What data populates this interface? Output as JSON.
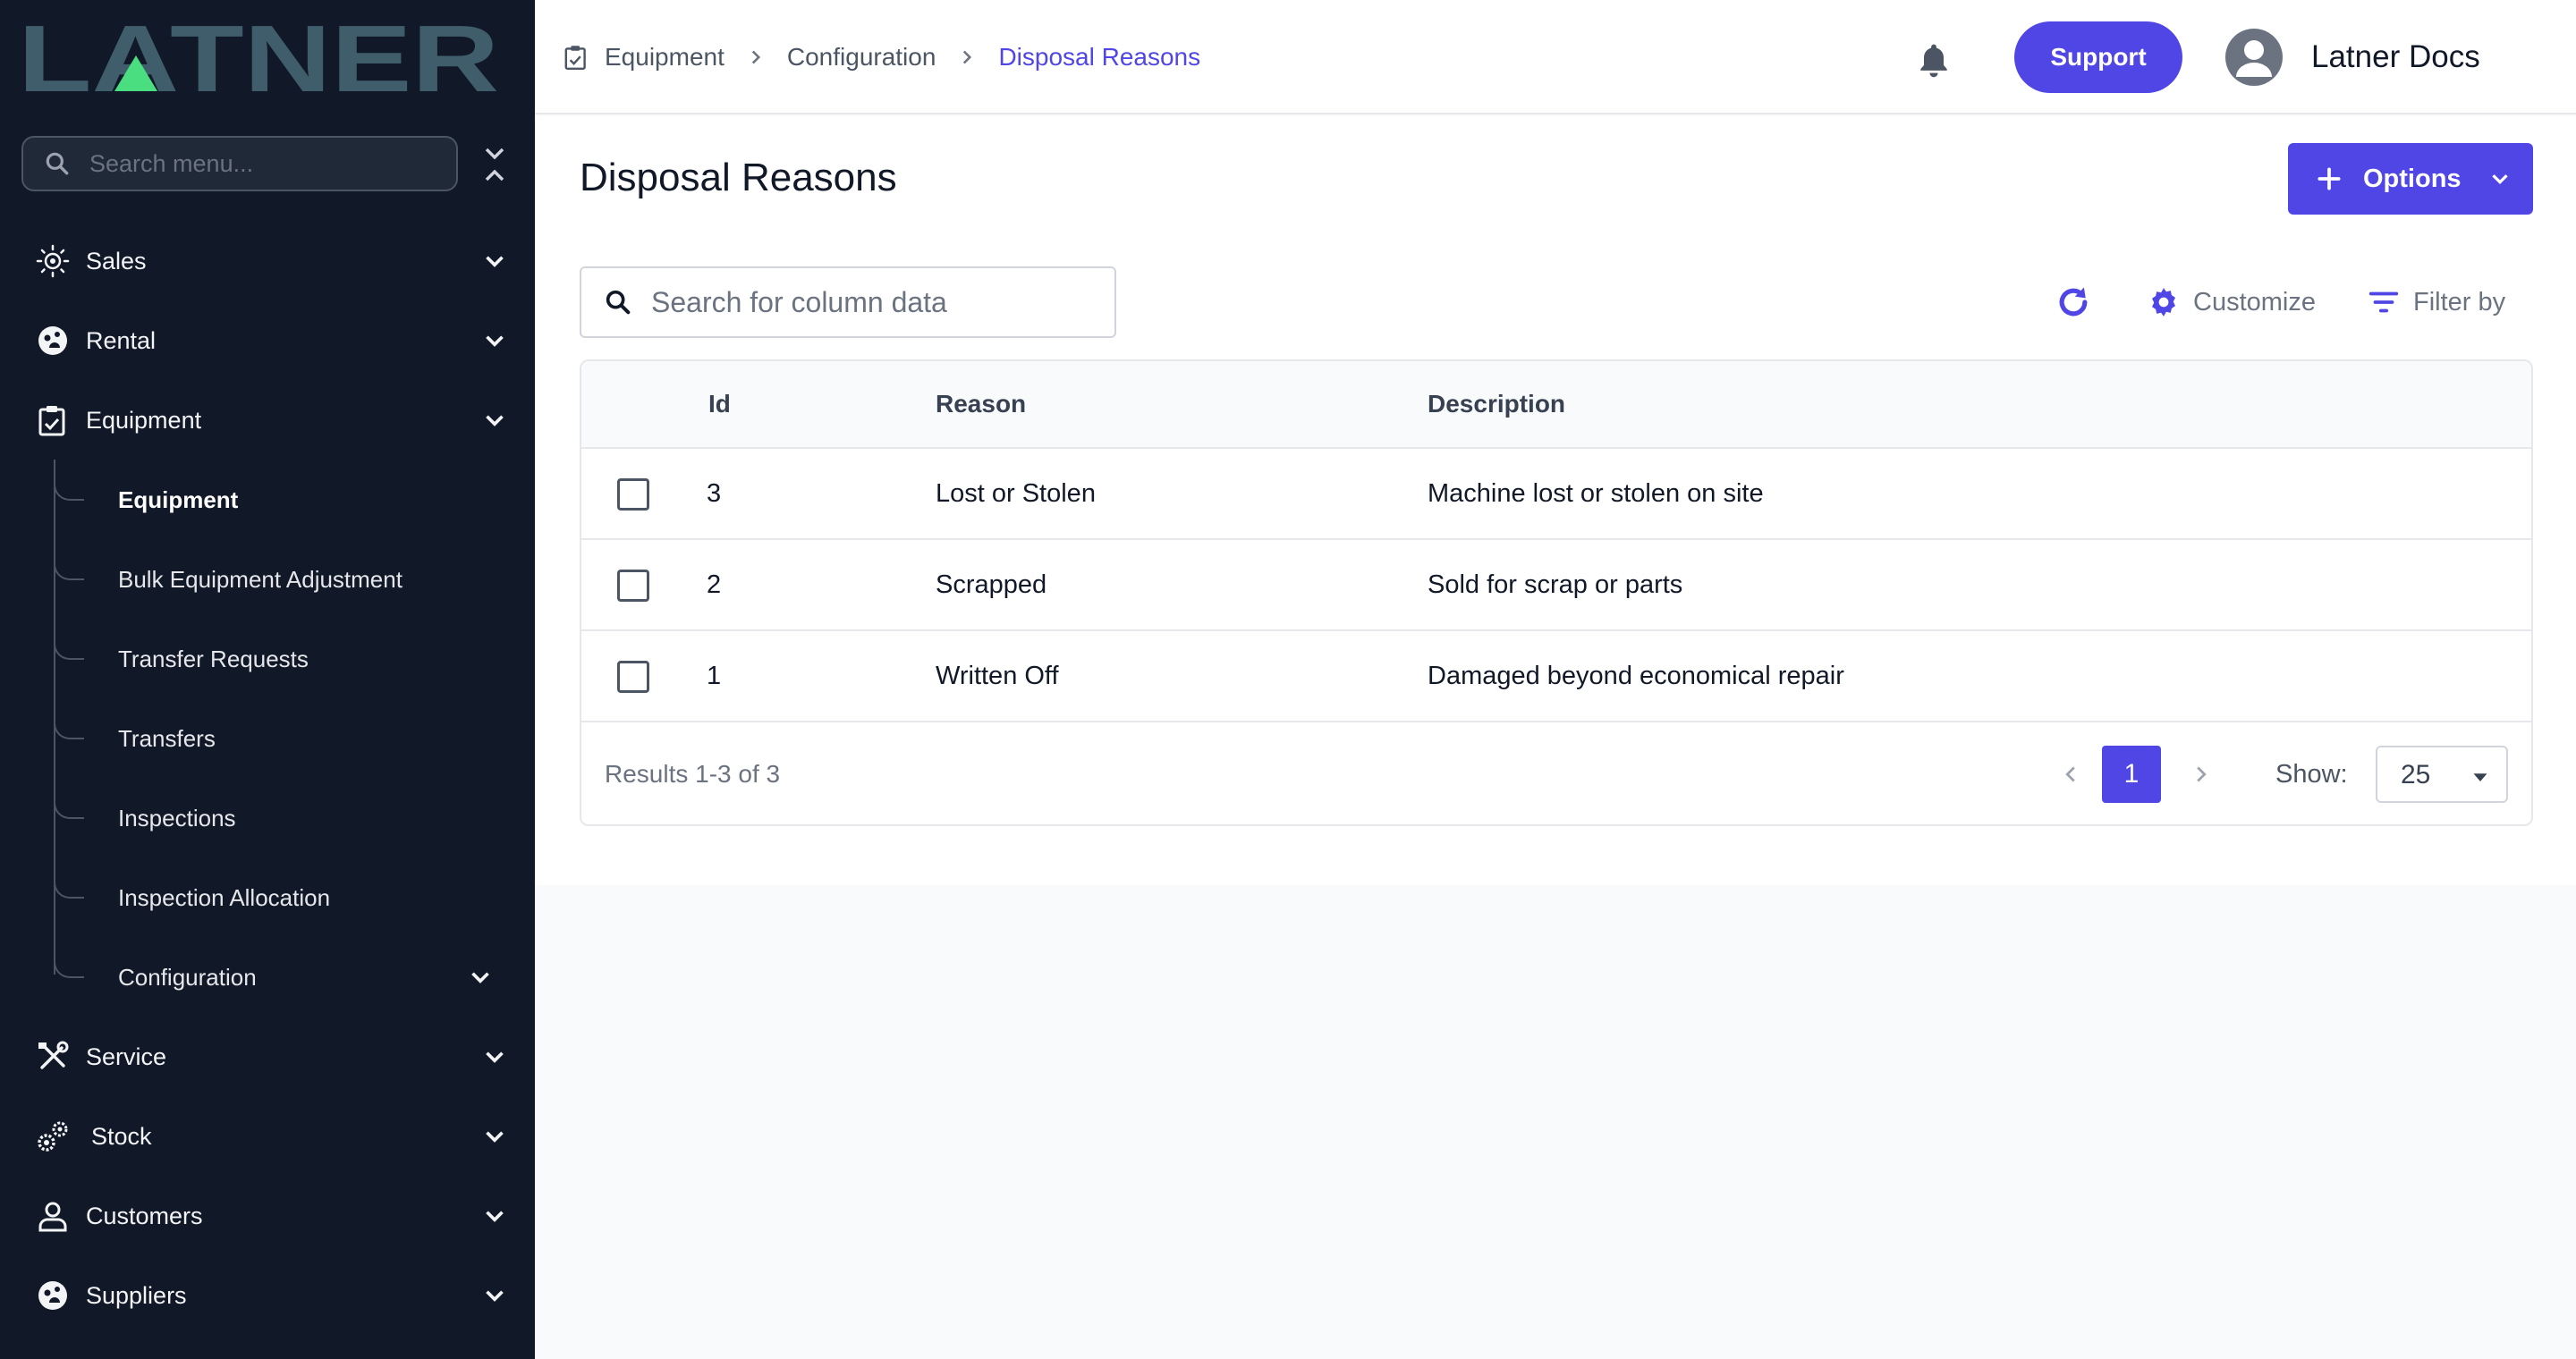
{
  "brand": {
    "logo_text": "LATNER",
    "accent": "#4f46e5",
    "sidebar_bg": "#111827"
  },
  "sidebar": {
    "search_placeholder": "Search menu...",
    "items": [
      {
        "label": "Sales",
        "icon": "sales-icon"
      },
      {
        "label": "Rental",
        "icon": "rental-icon"
      },
      {
        "label": "Equipment",
        "icon": "clipboard-icon",
        "expanded": true,
        "children": [
          {
            "label": "Equipment",
            "active": true
          },
          {
            "label": "Bulk Equipment Adjustment"
          },
          {
            "label": "Transfer Requests"
          },
          {
            "label": "Transfers"
          },
          {
            "label": "Inspections"
          },
          {
            "label": "Inspection Allocation"
          },
          {
            "label": "Configuration",
            "has_children": true
          }
        ]
      },
      {
        "label": "Service",
        "icon": "tools-icon"
      },
      {
        "label": "Stock",
        "icon": "gears-icon"
      },
      {
        "label": "Customers",
        "icon": "person-icon"
      },
      {
        "label": "Suppliers",
        "icon": "supplier-icon"
      }
    ]
  },
  "topbar": {
    "breadcrumb": [
      "Equipment",
      "Configuration",
      "Disposal Reasons"
    ],
    "support_label": "Support",
    "user_name": "Latner Docs"
  },
  "main": {
    "title": "Disposal Reasons",
    "options_label": "Options",
    "search_placeholder": "Search for column data",
    "customize_label": "Customize",
    "filter_label": "Filter by",
    "table": {
      "columns": [
        "Id",
        "Reason",
        "Description"
      ],
      "rows": [
        {
          "id": "3",
          "reason": "Lost or Stolen",
          "description": "Machine lost or stolen on site"
        },
        {
          "id": "2",
          "reason": "Scrapped",
          "description": "Sold for scrap or parts"
        },
        {
          "id": "1",
          "reason": "Written Off",
          "description": "Damaged beyond economical repair"
        }
      ]
    },
    "footer": {
      "results_text": "Results 1-3 of 3",
      "current_page": "1",
      "show_label": "Show:",
      "page_size": "25"
    }
  }
}
